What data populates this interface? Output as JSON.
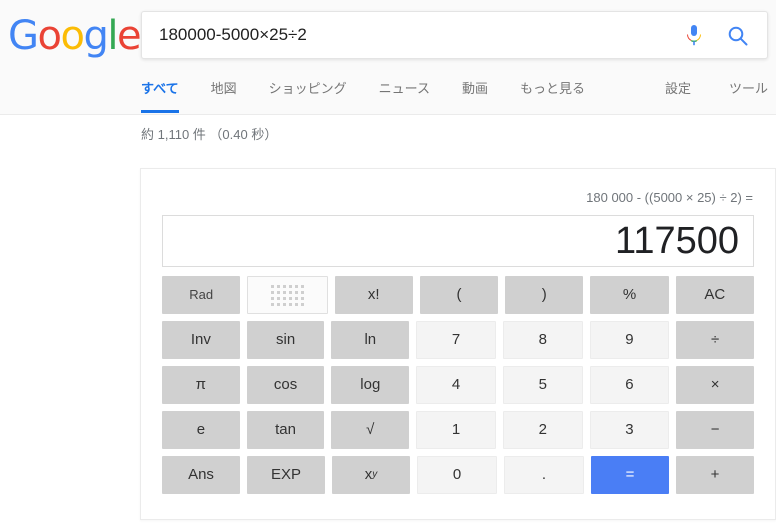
{
  "brand": {
    "logo_letters": [
      {
        "char": "G",
        "color": "#4285f4"
      },
      {
        "char": "o",
        "color": "#ea4335"
      },
      {
        "char": "o",
        "color": "#fbbc05"
      },
      {
        "char": "g",
        "color": "#4285f4"
      },
      {
        "char": "l",
        "color": "#34a853"
      },
      {
        "char": "e",
        "color": "#ea4335"
      }
    ]
  },
  "search": {
    "value": "180000-5000×25÷2",
    "placeholder": "",
    "mic_icon": "microphone-icon",
    "search_icon": "search-icon"
  },
  "tabs": {
    "left": [
      {
        "label": "すべて",
        "active": true
      },
      {
        "label": "地図",
        "active": false
      },
      {
        "label": "ショッピング",
        "active": false
      },
      {
        "label": "ニュース",
        "active": false
      },
      {
        "label": "動画",
        "active": false
      },
      {
        "label": "もっと見る",
        "active": false
      }
    ],
    "right": [
      {
        "label": "設定"
      },
      {
        "label": "ツール"
      }
    ]
  },
  "result_stats": "約 1,110 件 （0.40 秒）",
  "calculator": {
    "expression": "180 000 - ((5000 × 25) ÷ 2) =",
    "result": "117500",
    "accent_color": "#4a7ef5",
    "rows": [
      [
        {
          "label": "Rad",
          "kind": "rad",
          "name": "rad-deg-toggle"
        },
        {
          "label": "",
          "kind": "kb",
          "name": "keyboard-icon-button"
        },
        {
          "label": "x!",
          "kind": "fn",
          "name": "factorial-button"
        },
        {
          "label": "(",
          "kind": "fn",
          "name": "open-paren-button"
        },
        {
          "label": ")",
          "kind": "fn",
          "name": "close-paren-button"
        },
        {
          "label": "%",
          "kind": "fn",
          "name": "percent-button"
        },
        {
          "label": "AC",
          "kind": "fn",
          "name": "all-clear-button"
        }
      ],
      [
        {
          "label": "Inv",
          "kind": "fn",
          "name": "inverse-button"
        },
        {
          "label": "sin",
          "kind": "fn",
          "name": "sin-button"
        },
        {
          "label": "ln",
          "kind": "fn",
          "name": "ln-button"
        },
        {
          "label": "7",
          "kind": "num",
          "name": "digit-7-button"
        },
        {
          "label": "8",
          "kind": "num",
          "name": "digit-8-button"
        },
        {
          "label": "9",
          "kind": "num",
          "name": "digit-9-button"
        },
        {
          "label": "÷",
          "kind": "fn",
          "name": "divide-button"
        }
      ],
      [
        {
          "label": "π",
          "kind": "fn",
          "name": "pi-button"
        },
        {
          "label": "cos",
          "kind": "fn",
          "name": "cos-button"
        },
        {
          "label": "log",
          "kind": "fn",
          "name": "log-button"
        },
        {
          "label": "4",
          "kind": "num",
          "name": "digit-4-button"
        },
        {
          "label": "5",
          "kind": "num",
          "name": "digit-5-button"
        },
        {
          "label": "6",
          "kind": "num",
          "name": "digit-6-button"
        },
        {
          "label": "×",
          "kind": "fn",
          "name": "multiply-button"
        }
      ],
      [
        {
          "label": "e",
          "kind": "fn",
          "name": "euler-button"
        },
        {
          "label": "tan",
          "kind": "fn",
          "name": "tan-button"
        },
        {
          "label": "√",
          "kind": "fn",
          "name": "sqrt-button"
        },
        {
          "label": "1",
          "kind": "num",
          "name": "digit-1-button"
        },
        {
          "label": "2",
          "kind": "num",
          "name": "digit-2-button"
        },
        {
          "label": "3",
          "kind": "num",
          "name": "digit-3-button"
        },
        {
          "label": "−",
          "kind": "fn",
          "name": "minus-button"
        }
      ],
      [
        {
          "label": "Ans",
          "kind": "fn",
          "name": "answer-button"
        },
        {
          "label": "EXP",
          "kind": "fn",
          "name": "exponent-button"
        },
        {
          "label": "xy",
          "kind": "fn",
          "name": "power-button",
          "sup": true
        },
        {
          "label": "0",
          "kind": "num",
          "name": "digit-0-button"
        },
        {
          "label": ".",
          "kind": "num",
          "name": "decimal-point-button"
        },
        {
          "label": "=",
          "kind": "eq",
          "name": "equals-button"
        },
        {
          "label": "+",
          "kind": "fn",
          "name": "plus-button"
        }
      ]
    ]
  }
}
